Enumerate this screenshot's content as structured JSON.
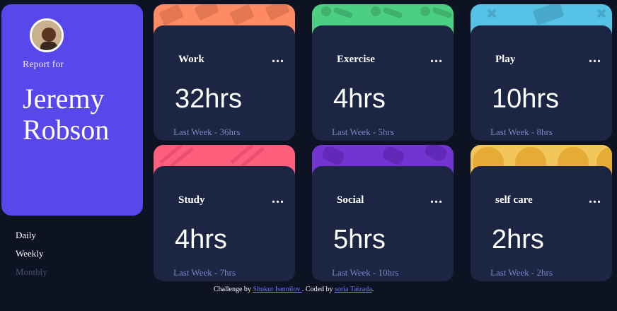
{
  "profile": {
    "report_for": "Report for",
    "name": "Jeremy Robson",
    "avatar_alt": "avatar"
  },
  "timeframes": [
    "Daily",
    "Weekly",
    "Monthly"
  ],
  "active_timeframe": "Weekly",
  "cards": [
    {
      "title": "Work",
      "hours": "32hrs",
      "previous": "Last Week - 36hrs",
      "color": "#ff8b64"
    },
    {
      "title": "Exercise",
      "hours": "4hrs",
      "previous": "Last Week - 5hrs",
      "color": "#4bcf82"
    },
    {
      "title": "Play",
      "hours": "10hrs",
      "previous": "Last Week - 8hrs",
      "color": "#56c2e6"
    },
    {
      "title": "Study",
      "hours": "4hrs",
      "previous": "Last Week - 7hrs",
      "color": "#ff5e7d"
    },
    {
      "title": "Social",
      "hours": "5hrs",
      "previous": "Last Week - 10hrs",
      "color": "#7335d2"
    },
    {
      "title": "self care",
      "hours": "2hrs",
      "previous": "Last Week - 2hrs",
      "color": "#f1c75b"
    }
  ],
  "menu_dots": "...",
  "footer": {
    "prefix": "Challenge by",
    "author1": "Shukur Ismoilov ",
    "middle": ". Coded by",
    "author2": "soria Taizada",
    "suffix": "."
  }
}
